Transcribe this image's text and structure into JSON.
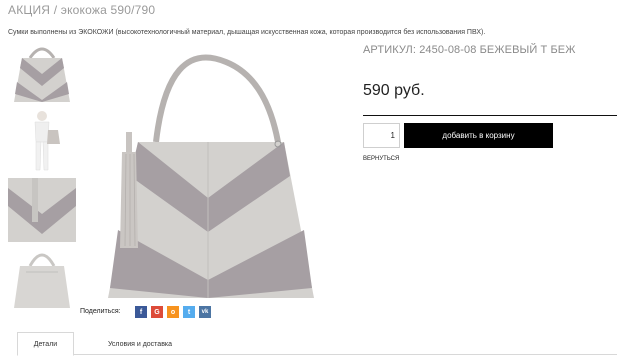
{
  "page": {
    "title": "АКЦИЯ / экокожа 590/790",
    "description": "Сумки выполнены из ЭКОКОЖИ (высокотехнологичный материал, дышащая искусственная кожа, которая производится без использования ПВХ)."
  },
  "product": {
    "sku": "АРТИКУЛ: 2450-08-08 БЕЖЕВЫЙ Т БЕЖ",
    "price": "590 руб.",
    "quantity": "1",
    "add_to_cart_label": "добавить в корзину",
    "back_label": "ВЕРНУТЬСЯ"
  },
  "gallery": {
    "thumbnails": [
      "bag-front-thumbnail",
      "model-with-bag-thumbnail",
      "bag-detail-thumbnail",
      "bag-back-thumbnail"
    ],
    "main_image": "bag-main-photo",
    "colors": {
      "dark": "#a69fa3",
      "light": "#d3d1ce",
      "handle": "#b6b2b0"
    }
  },
  "share": {
    "label": "Поделиться:",
    "buttons": [
      {
        "icon": "facebook-icon",
        "glyph": "f",
        "color": "#3b5998"
      },
      {
        "icon": "google-plus-icon",
        "glyph": "G",
        "color": "#dd4b39"
      },
      {
        "icon": "odnoklassniki-icon",
        "glyph": "o",
        "color": "#f7931e"
      },
      {
        "icon": "twitter-icon",
        "glyph": "t",
        "color": "#55acee"
      },
      {
        "icon": "vk-icon",
        "glyph": "vk",
        "color": "#4c75a3"
      }
    ]
  },
  "tabs": [
    {
      "label": "Детали",
      "active": true
    },
    {
      "label": "Условия и доставка",
      "active": false
    }
  ]
}
